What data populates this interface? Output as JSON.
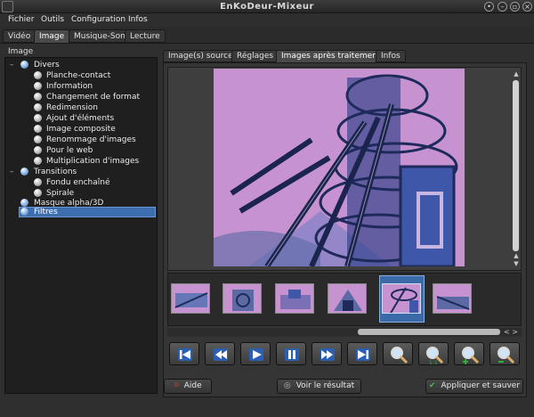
{
  "window": {
    "title": "EnKoDeur-Mixeur"
  },
  "menu": [
    {
      "label": "Fichier"
    },
    {
      "label": "Outils"
    },
    {
      "label": "Configuration"
    },
    {
      "label": "Infos"
    }
  ],
  "main_tabs": [
    {
      "label": "Vidéo"
    },
    {
      "label": "Image"
    },
    {
      "label": "Musique-Son"
    },
    {
      "label": "Lecture"
    }
  ],
  "active_main_tab": "Image",
  "tree": {
    "header": "Image",
    "items": [
      {
        "label": "Divers"
      },
      {
        "label": "Planche-contact"
      },
      {
        "label": "Information"
      },
      {
        "label": "Changement de format"
      },
      {
        "label": "Redimension"
      },
      {
        "label": "Ajout d'éléments"
      },
      {
        "label": "Image composite"
      },
      {
        "label": "Renommage d'images"
      },
      {
        "label": "Pour le web"
      },
      {
        "label": "Multiplication d'images"
      },
      {
        "label": "Transitions"
      },
      {
        "label": "Fondu enchaîné"
      },
      {
        "label": "Spirale"
      },
      {
        "label": "Masque alpha/3D"
      },
      {
        "label": "Filtres"
      }
    ],
    "selected": "Filtres"
  },
  "panel_tabs": [
    {
      "label": "Image(s) source"
    },
    {
      "label": "Réglages"
    },
    {
      "label": "Images après traitement"
    },
    {
      "label": "Infos"
    }
  ],
  "active_panel_tab": "Images après traitement",
  "thumbnails_count_visible": 6,
  "selected_thumbnail": 5,
  "toolbar_icons": [
    "skip-first-icon",
    "rewind-icon",
    "play-icon",
    "pause-icon",
    "fast-forward-icon",
    "skip-last-icon",
    "zoom-icon",
    "zoom-fit-icon",
    "zoom-in-icon",
    "zoom-out-icon"
  ],
  "footer": {
    "help_label": "Aide",
    "preview_label": "Voir le résultat",
    "apply_label": "Appliquer et sauver"
  },
  "colors": {
    "accent": "#3d6fb0",
    "image_tint": "#c692cf",
    "image_ink": "#1d2a5a",
    "window_bg": "#2b2b2b"
  }
}
